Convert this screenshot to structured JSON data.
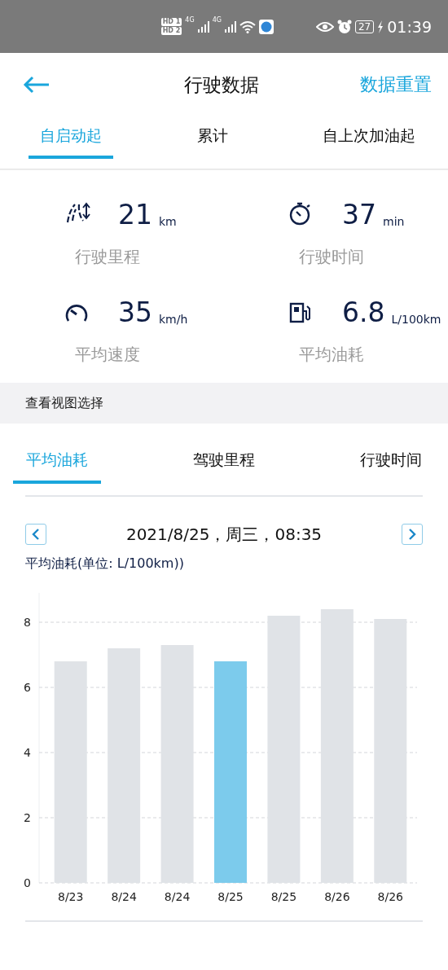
{
  "status_bar": {
    "sim_badges": [
      "HD 1",
      "HD 2"
    ],
    "network_labels": [
      "4G",
      "4G"
    ],
    "battery": "27",
    "time": "01:39"
  },
  "header": {
    "title": "行驶数据",
    "action": "数据重置"
  },
  "tabs": [
    {
      "label": "自启动起",
      "selected": true
    },
    {
      "label": "累计",
      "selected": false
    },
    {
      "label": "自上次加油起",
      "selected": false
    }
  ],
  "stats": [
    {
      "kind": "distance",
      "value": "21",
      "unit": "km",
      "label": "行驶里程"
    },
    {
      "kind": "time",
      "value": "37",
      "unit": "min",
      "label": "行驶时间"
    },
    {
      "kind": "speed",
      "value": "35",
      "unit": "km/h",
      "label": "平均速度"
    },
    {
      "kind": "fuel",
      "value": "6.8",
      "unit": "L/100km",
      "label": "平均油耗"
    }
  ],
  "view_section": {
    "title": "查看视图选择"
  },
  "view_tabs": [
    {
      "label": "平均油耗",
      "selected": true
    },
    {
      "label": "驾驶里程",
      "selected": false
    },
    {
      "label": "行驶时间",
      "selected": false
    }
  ],
  "date_nav": {
    "date": "2021/8/25，周三，08:35"
  },
  "chart": {
    "title": "平均油耗(单位: L/100km))",
    "bars": [
      {
        "selected": false
      },
      {
        "selected": false
      },
      {
        "selected": false
      },
      {
        "selected": true
      },
      {
        "selected": false
      },
      {
        "selected": false
      },
      {
        "selected": false
      }
    ],
    "chart_data": {
      "type": "bar",
      "categories": [
        "8/23",
        "8/24",
        "8/24",
        "8/25",
        "8/25",
        "8/26",
        "8/26"
      ],
      "values": [
        6.8,
        7.2,
        7.3,
        6.8,
        8.2,
        8.4,
        8.1
      ],
      "ylim": [
        0,
        8.9
      ],
      "yticks": [
        0,
        2,
        4,
        6,
        8
      ],
      "grid": true
    }
  }
}
